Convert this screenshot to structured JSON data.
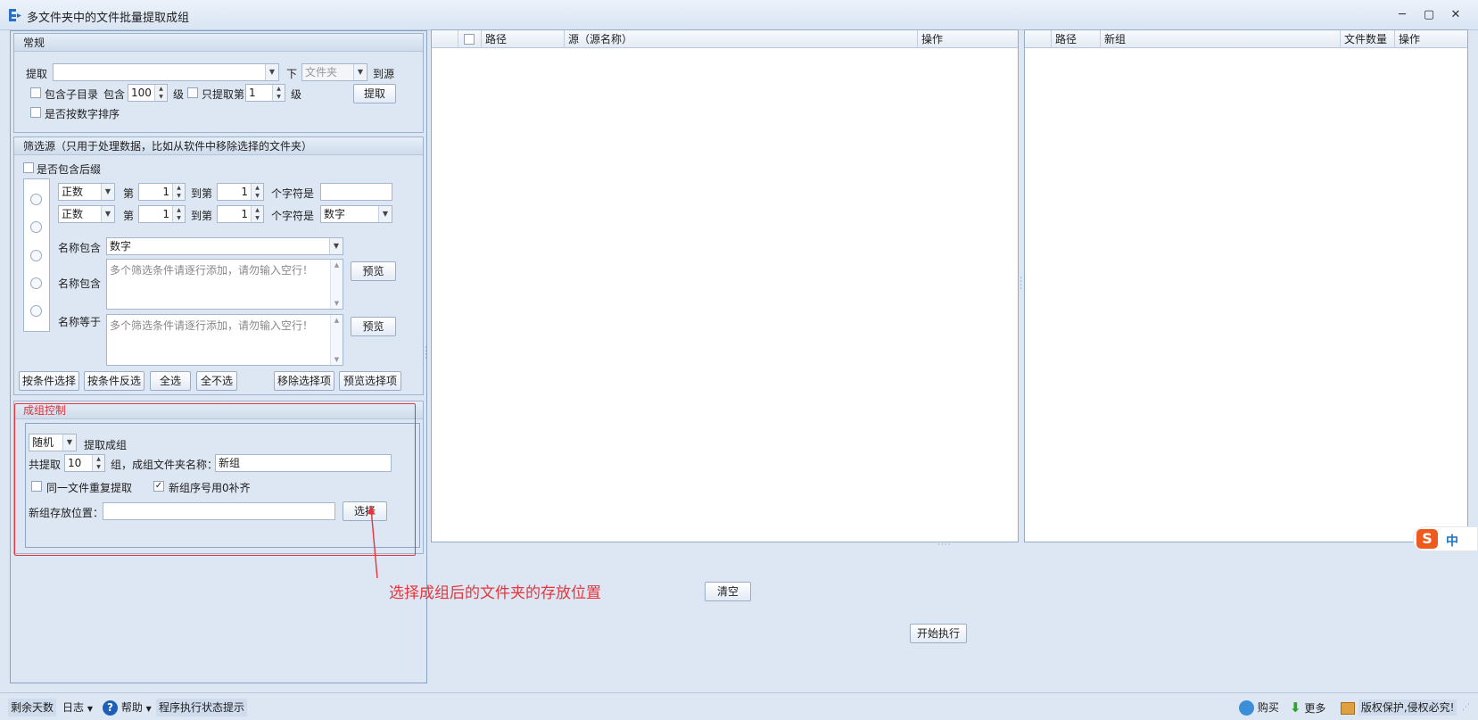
{
  "window": {
    "title": "多文件夹中的文件批量提取成组",
    "minimize": "─",
    "maximize": "▢",
    "close": "✕"
  },
  "general": {
    "header": "常规",
    "extract_label": "提取",
    "extract_value": "",
    "below_label": "下",
    "folder_type": "文件夹",
    "to_source_label": "到源",
    "include_subdirs": "包含子目录",
    "include_label": "包含",
    "levels_value": "100",
    "level_unit": "级",
    "only_extract_label": "只提取第",
    "only_level_value": "1",
    "only_level_unit": "级",
    "extract_button": "提取",
    "numeric_sort": "是否按数字排序"
  },
  "filter": {
    "header": "筛选源（只用于处理数据，比如从软件中移除选择的文件夹）",
    "include_suffix": "是否包含后缀",
    "row1": {
      "mode": "正数",
      "nth": "第",
      "from": "1",
      "to_label": "到第",
      "to": "1",
      "char_label": "个字符是",
      "value": ""
    },
    "row2": {
      "mode": "正数",
      "nth": "第",
      "from": "1",
      "to_label": "到第",
      "to": "1",
      "char_label": "个字符是",
      "value": "数字"
    },
    "name_contains_label": "名称包含",
    "name_contains_value": "数字",
    "name_contains2_label": "名称包含",
    "textarea_placeholder": "多个筛选条件请逐行添加，请勿输入空行！",
    "name_equals_label": "名称等于",
    "preview_button": "预览",
    "buttons": {
      "select_by_condition": "按条件选择",
      "invert_by_condition": "按条件反选",
      "select_all": "全选",
      "select_none": "全不选",
      "remove_selected": "移除选择项",
      "preview_selected": "预览选择项"
    }
  },
  "group_control": {
    "header": "成组控制",
    "mode": "随机",
    "extract_group": "提取成组",
    "total_label": "共提取",
    "total_value": "10",
    "group_name_label": "组，成组文件夹名称：",
    "group_name_value": "新组",
    "same_file_repeat": "同一文件重复提取",
    "zero_pad": "新组序号用0补齐",
    "save_location_label": "新组存放位置：",
    "save_location_value": "",
    "choose_button": "选择"
  },
  "annotation": "选择成组后的文件夹的存放位置",
  "source_grid": {
    "columns": [
      "路径",
      "源（源名称）",
      "操作"
    ]
  },
  "group_grid": {
    "columns": [
      "路径",
      "新组",
      "文件数量",
      "操作"
    ]
  },
  "actions": {
    "clear": "清空",
    "start": "开始执行"
  },
  "ime": {
    "label": "中"
  },
  "statusbar": {
    "days_left": "剩余天数",
    "log": "日志",
    "help": "帮助",
    "exec_status": "程序执行状态提示",
    "buy": "购买",
    "more": "更多",
    "copyright": "版权保护,侵权必究!"
  },
  "colors": {
    "highlight": "#e8343c",
    "accent": "#1a73c8"
  }
}
